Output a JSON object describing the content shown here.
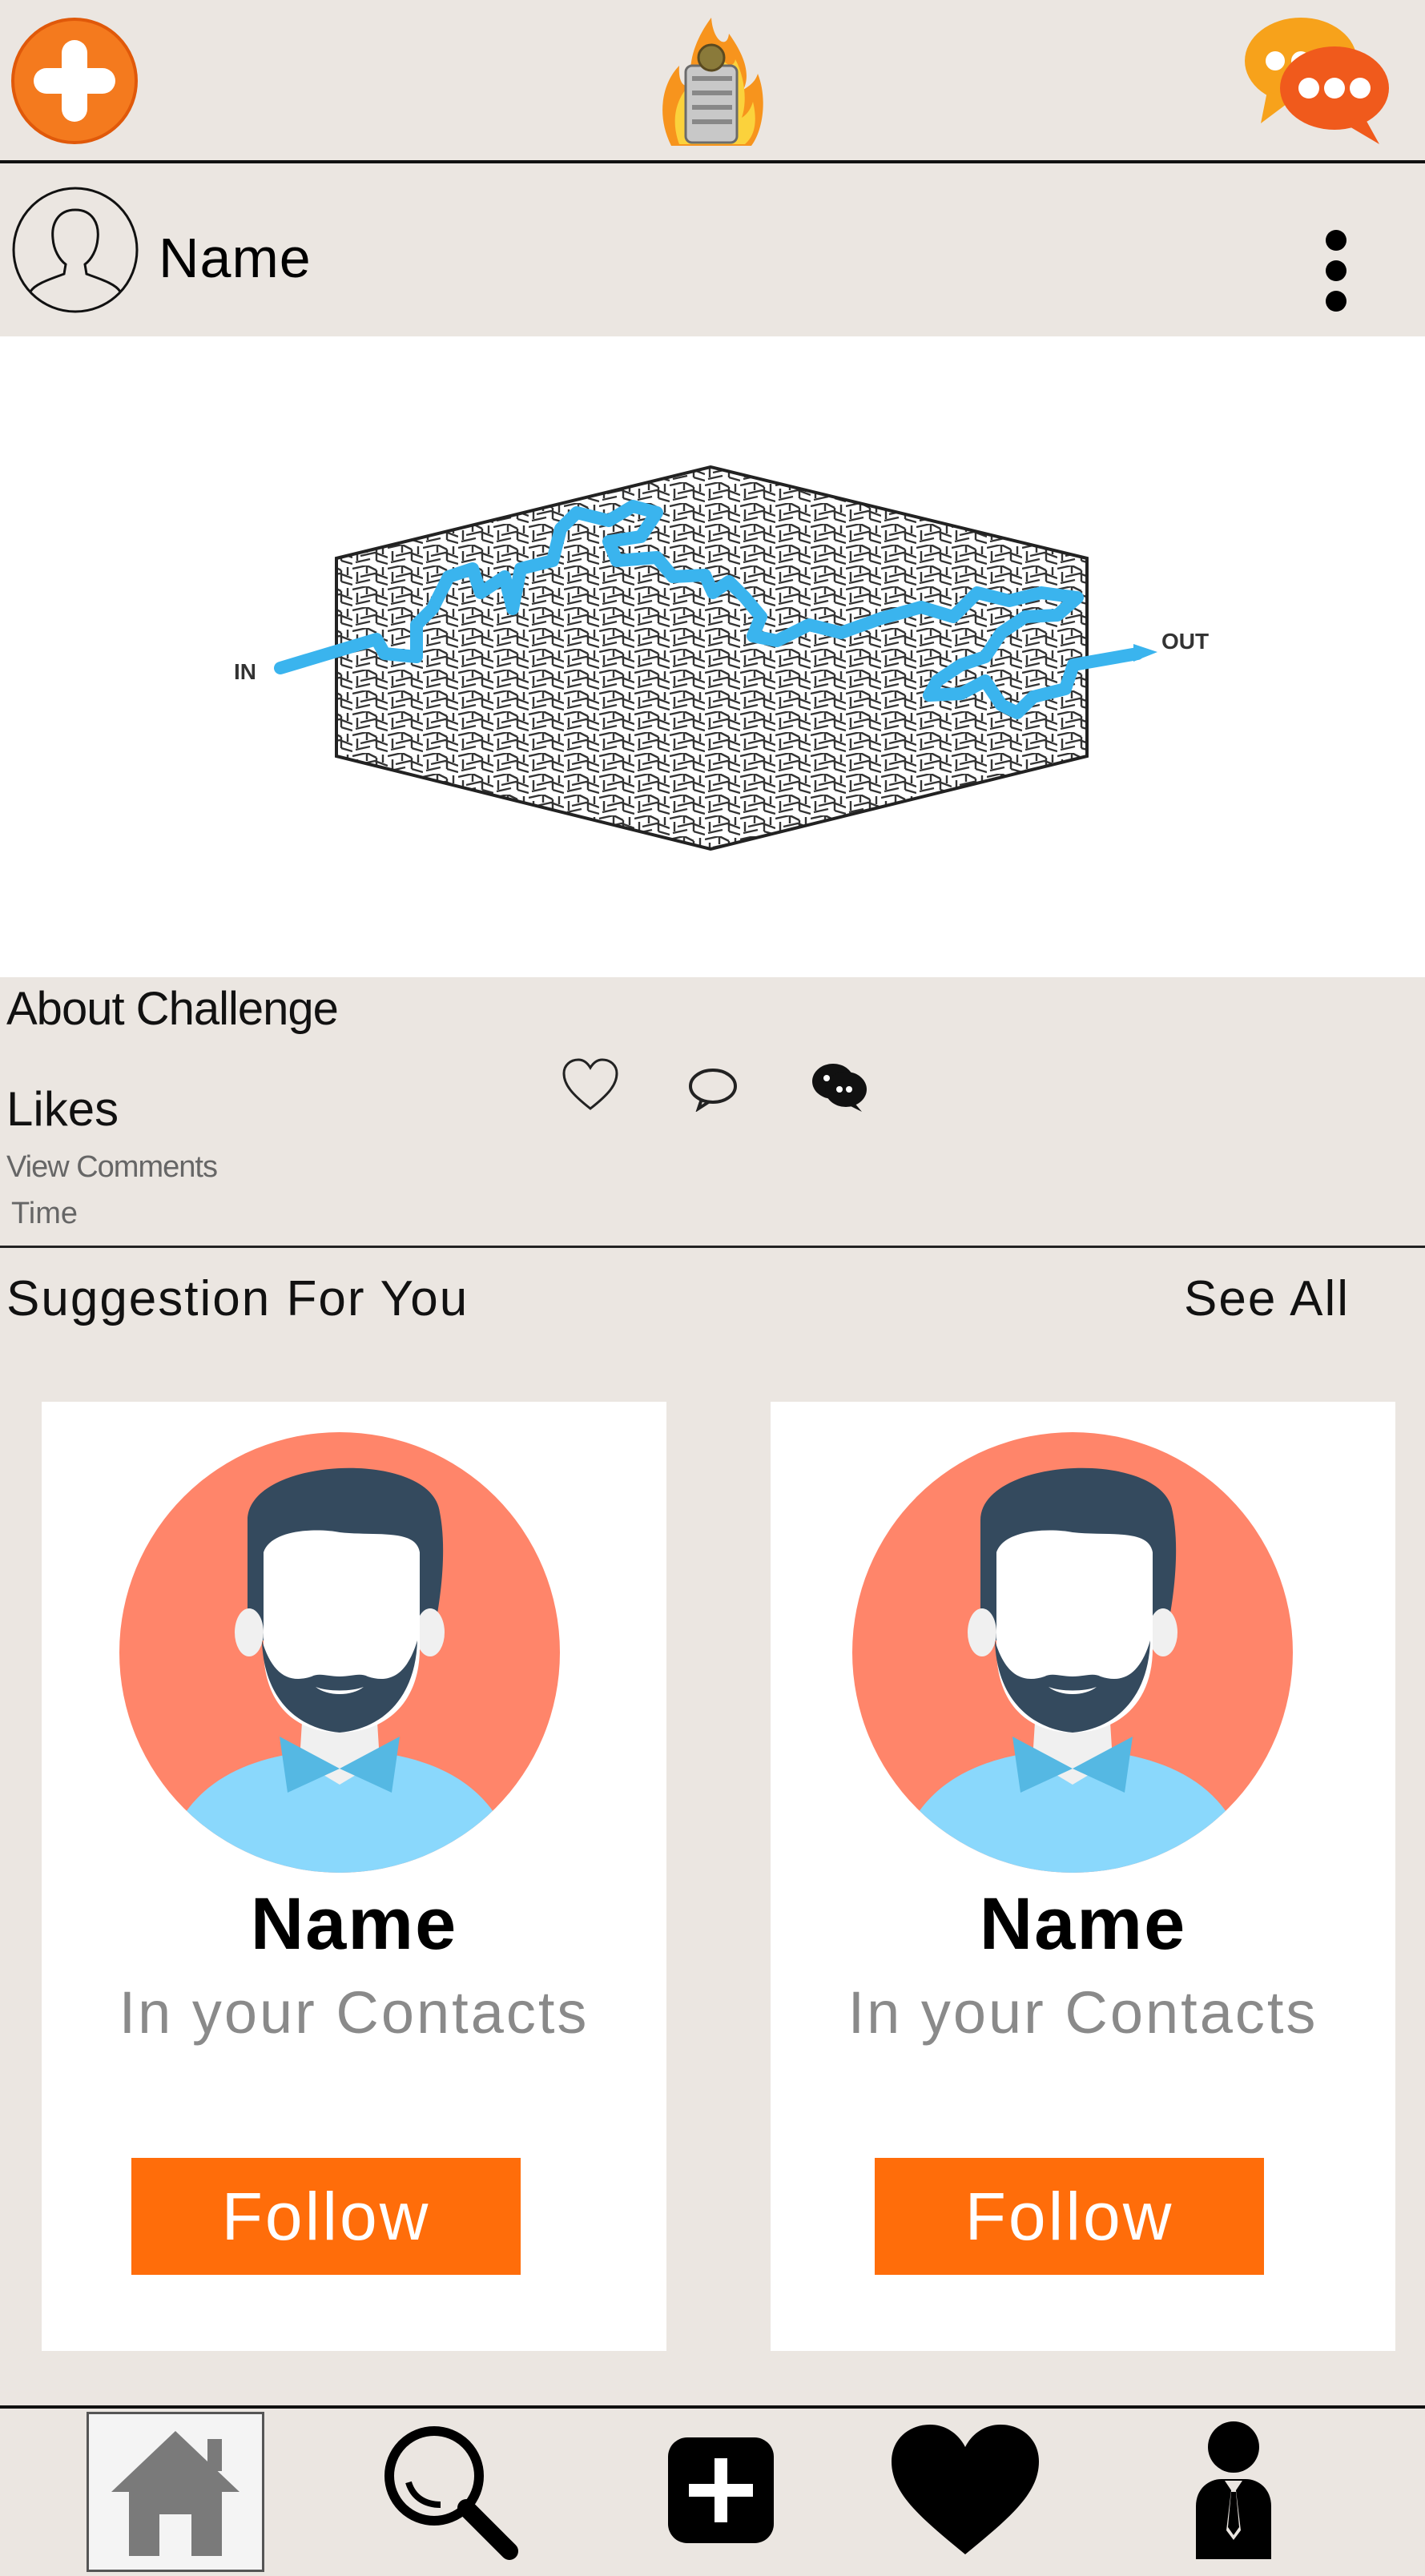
{
  "header": {
    "add_icon": "plus-circle-icon",
    "logo_icon": "flame-logo-icon",
    "chat_icon": "chat-bubbles-icon"
  },
  "post": {
    "author_name": "Name",
    "menu_icon": "more-vertical-icon",
    "image": {
      "in_label": "IN",
      "out_label": "OUT"
    },
    "about": "About Challenge",
    "likes": "Likes",
    "view_comments": "View Comments",
    "time": "Time",
    "actions": {
      "like_icon": "heart-outline-icon",
      "comment_icon": "speech-bubble-icon",
      "message_icon": "chat-icon"
    }
  },
  "suggestions": {
    "title": "Suggestion For You",
    "see_all": "See All",
    "cards": [
      {
        "name": "Name",
        "subtitle": "In your Contacts",
        "button": "Follow"
      },
      {
        "name": "Name",
        "subtitle": "In your Contacts",
        "button": "Follow"
      }
    ]
  },
  "bottom_nav": {
    "items": [
      {
        "icon": "home-icon",
        "active": true
      },
      {
        "icon": "search-icon",
        "active": false
      },
      {
        "icon": "add-post-icon",
        "active": false
      },
      {
        "icon": "heart-icon",
        "active": false
      },
      {
        "icon": "profile-icon",
        "active": false
      }
    ]
  },
  "colors": {
    "background": "#ebe6e1",
    "accent": "#ff6d0a",
    "maze_path": "#3ab4ee",
    "avatar_bg": "#ff856a",
    "avatar_hair": "#344a5e",
    "avatar_shirt": "#8ad8fc"
  }
}
